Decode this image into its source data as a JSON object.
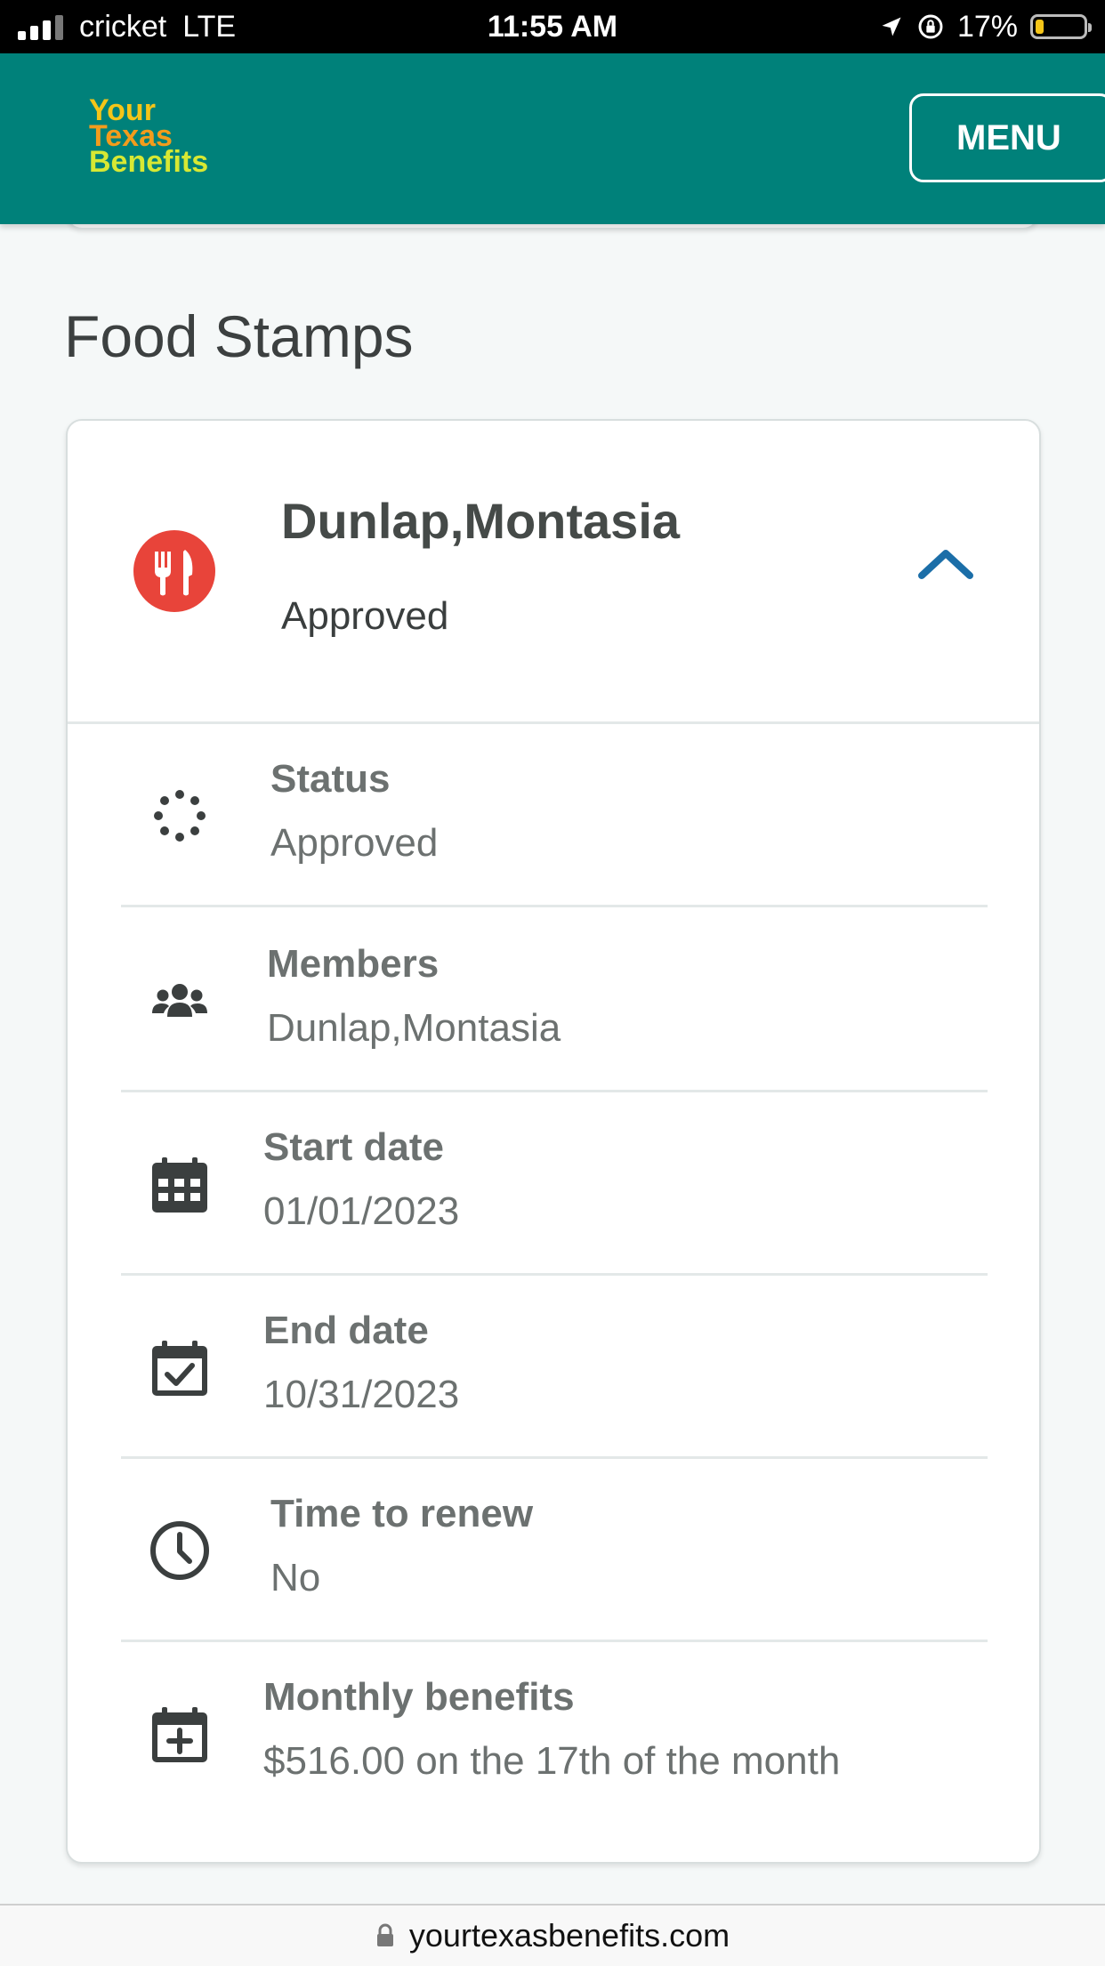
{
  "status_bar": {
    "carrier": "cricket",
    "network": "LTE",
    "time": "11:55 AM",
    "battery_percent": "17%",
    "battery_level": 0.17
  },
  "header": {
    "logo_lines": [
      "Your",
      "Texas",
      "Benefits"
    ],
    "menu_label": "MENU",
    "background_color": "#00817a"
  },
  "section": {
    "title": "Food Stamps"
  },
  "card": {
    "name": "Dunlap,Montasia",
    "status": "Approved",
    "icon": "fork-knife-icon",
    "accent_color": "#e8443a",
    "expanded": true,
    "rows": [
      {
        "label": "Status",
        "value": "Approved",
        "icon": "spinner-dots-icon"
      },
      {
        "label": "Members",
        "value": "Dunlap,Montasia",
        "icon": "people-group-icon"
      },
      {
        "label": "Start date",
        "value": "01/01/2023",
        "icon": "calendar-grid-icon"
      },
      {
        "label": "End date",
        "value": "10/31/2023",
        "icon": "calendar-check-icon"
      },
      {
        "label": "Time to renew",
        "value": "No",
        "icon": "clock-icon"
      },
      {
        "label": "Monthly benefits",
        "value": "$516.00 on the 17th of the month",
        "icon": "calendar-plus-icon"
      }
    ]
  },
  "url_bar": {
    "url": "yourtexasbenefits.com"
  }
}
